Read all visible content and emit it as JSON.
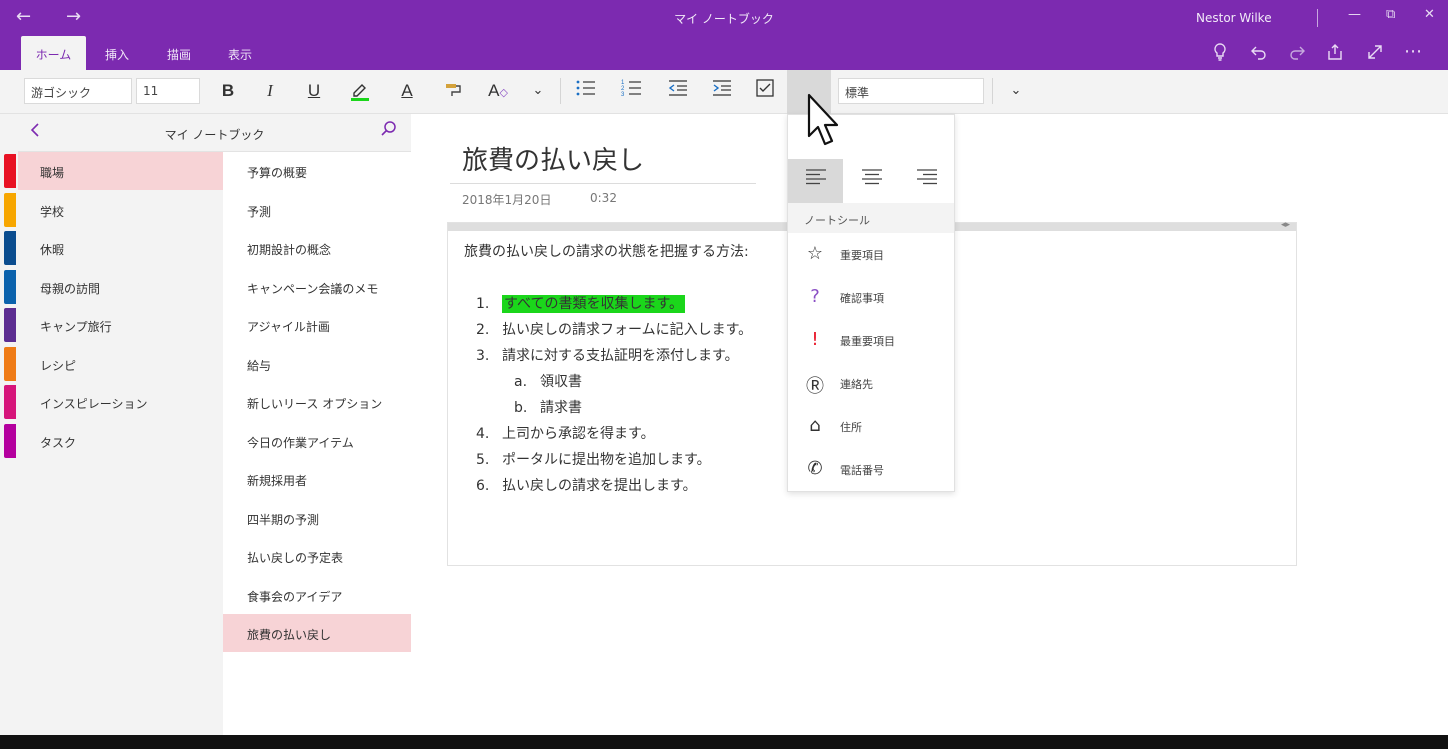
{
  "window": {
    "title": "マイ ノートブック",
    "user": "Nestor Wilke",
    "back_glyph": "←",
    "forward_glyph": "→",
    "minimize_glyph": "—",
    "restore_glyph": "⧉",
    "close_glyph": "✕"
  },
  "tabs": [
    {
      "label": "ホーム"
    },
    {
      "label": "挿入"
    },
    {
      "label": "描画"
    },
    {
      "label": "表示"
    }
  ],
  "ribbon_actions": {
    "tell_me": "lightbulb-icon",
    "undo": "undo-icon",
    "redo": "redo-icon",
    "share": "share-icon",
    "fullscreen": "fullscreen-icon",
    "more_glyph": "⋯"
  },
  "toolbar": {
    "font_name": "游ゴシック",
    "font_size": "11",
    "style": "標準",
    "bold": "B",
    "italic": "I",
    "underline": "U",
    "font_color_glyph": "A",
    "clear_glyph": "A"
  },
  "sidebar": {
    "notebook_title": "マイ ノートブック",
    "sections": [
      {
        "label": "職場",
        "color": "#e81123"
      },
      {
        "label": "学校",
        "color": "#f7a600"
      },
      {
        "label": "休暇",
        "color": "#0b4d8f"
      },
      {
        "label": "母親の訪問",
        "color": "#0b62ac"
      },
      {
        "label": "キャンプ旅行",
        "color": "#5c2d91"
      },
      {
        "label": "レシピ",
        "color": "#ef7b16"
      },
      {
        "label": "インスピレーション",
        "color": "#d6157a"
      },
      {
        "label": "タスク",
        "color": "#b4009e"
      }
    ],
    "pages": [
      {
        "label": "予算の概要"
      },
      {
        "label": "予測"
      },
      {
        "label": "初期設計の概念"
      },
      {
        "label": "キャンペーン会議のメモ"
      },
      {
        "label": "アジャイル計画"
      },
      {
        "label": "給与"
      },
      {
        "label": "新しいリース オプション"
      },
      {
        "label": "今日の作業アイテム"
      },
      {
        "label": "新規採用者"
      },
      {
        "label": "四半期の予測"
      },
      {
        "label": "払い戻しの予定表"
      },
      {
        "label": "食事会のアイデア"
      },
      {
        "label": "旅費の払い戻し"
      }
    ]
  },
  "page": {
    "title": "旅費の払い戻し",
    "date": "2018年1月20日",
    "time": "0:32",
    "intro": "旅費の払い戻しの請求の状態を把握する方法:",
    "items": [
      {
        "num": "1.",
        "text": "すべての書類を収集します。"
      },
      {
        "num": "2.",
        "text": "払い戻しの請求フォームに記入します。"
      },
      {
        "num": "3.",
        "text": "請求に対する支払証明を添付します。"
      },
      {
        "num": "a.",
        "text": "領収書"
      },
      {
        "num": "b.",
        "text": "請求書"
      },
      {
        "num": "4.",
        "text": "上司から承認を得ます。"
      },
      {
        "num": "5.",
        "text": "ポータルに提出物を追加します。"
      },
      {
        "num": "6.",
        "text": "払い戻しの請求を提出します。"
      }
    ],
    "highlight_color": "#1bd61b"
  },
  "dropdown": {
    "tags_header": "ノートシール",
    "tags": [
      {
        "label": "重要項目",
        "icon": "star-icon",
        "glyph": "☆",
        "color": "#333333"
      },
      {
        "label": "確認事項",
        "icon": "question-icon",
        "glyph": "?",
        "color": "#8a4fc4"
      },
      {
        "label": "最重要項目",
        "icon": "exclamation-icon",
        "glyph": "!",
        "color": "#e81123"
      },
      {
        "label": "連絡先",
        "icon": "contact-icon",
        "glyph": "Ⓡ",
        "color": "#333333"
      },
      {
        "label": "住所",
        "icon": "home-icon",
        "glyph": "⌂",
        "color": "#333333"
      },
      {
        "label": "電話番号",
        "icon": "phone-icon",
        "glyph": "✆",
        "color": "#333333"
      }
    ]
  }
}
